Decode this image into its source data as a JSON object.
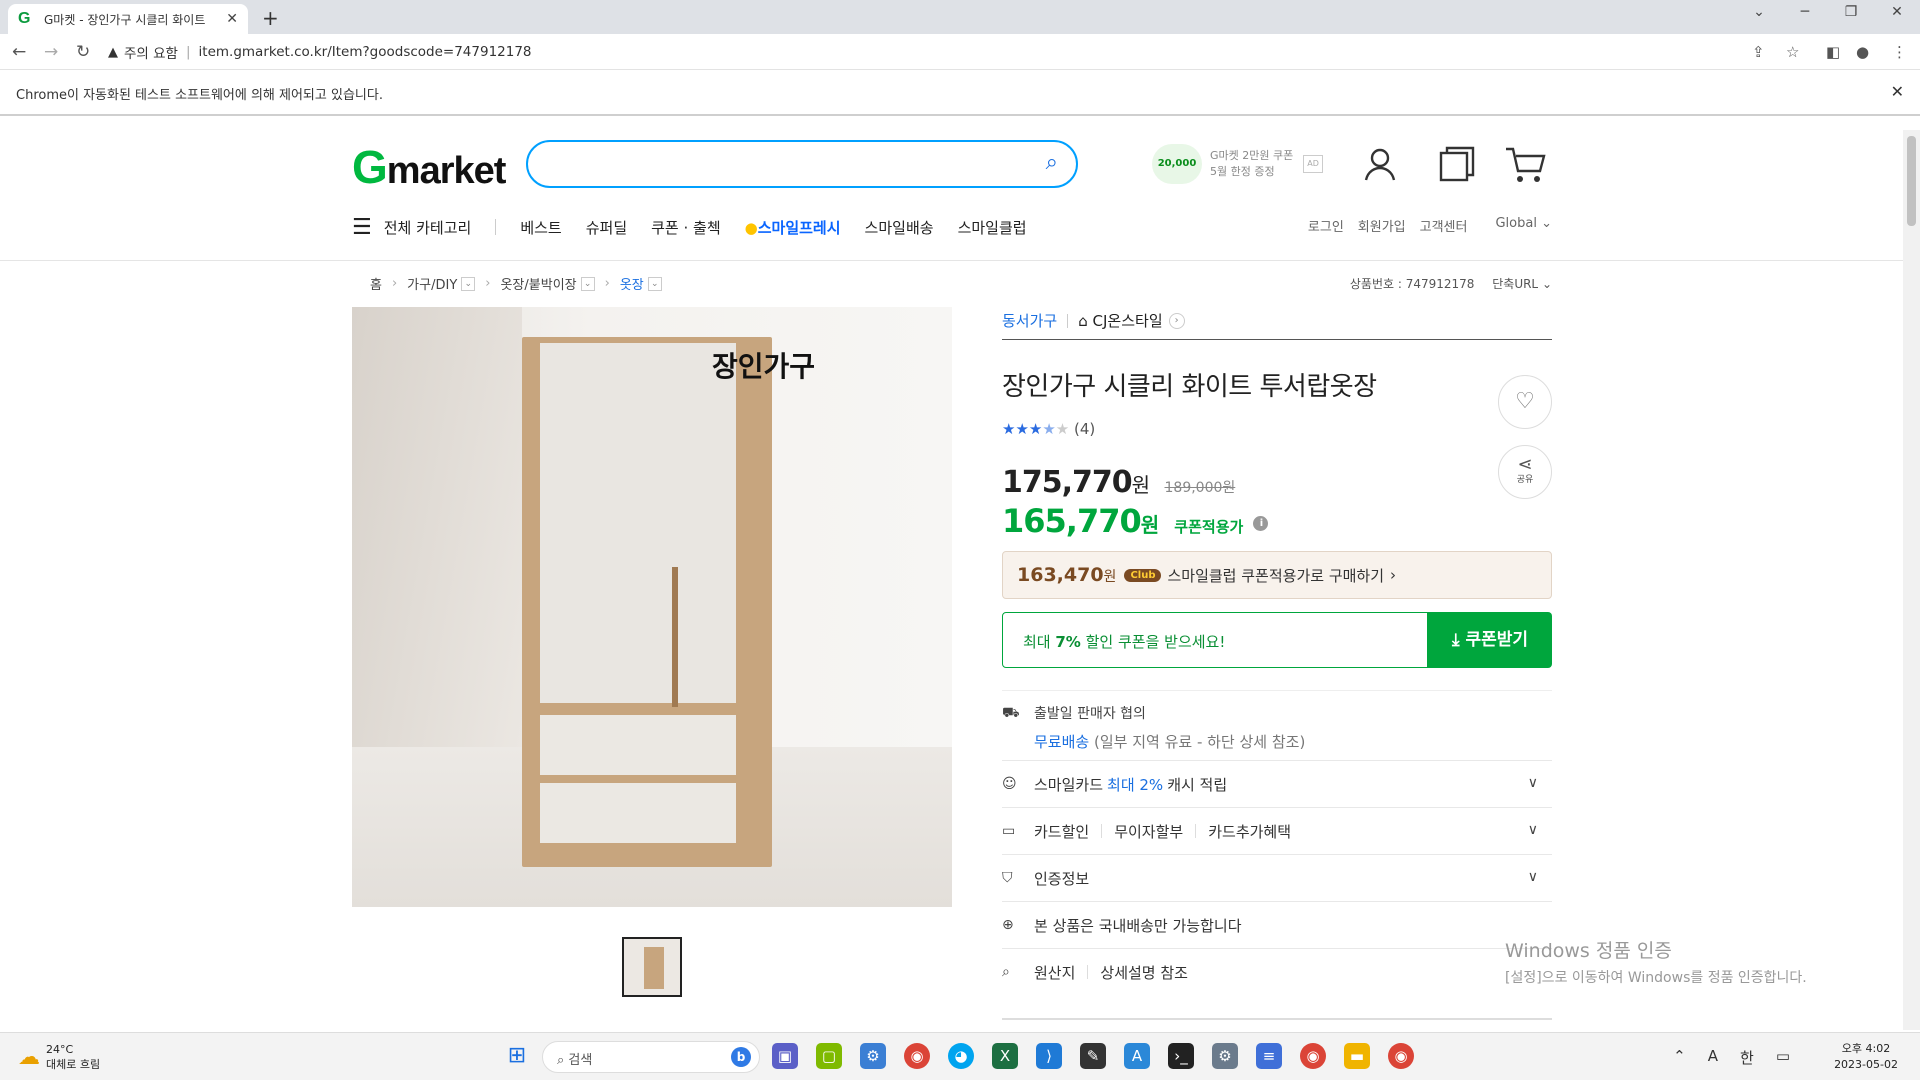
{
  "browser": {
    "tab_title": "G마켓 - 장인가구 시클리 화이트",
    "favicon": "G",
    "security": "주의 요함",
    "url": "item.gmarket.co.kr/Item?goodscode=747912178",
    "automation_notice": "Chrome이 자동화된 테스트 소프트웨어에 의해 제어되고 있습니다."
  },
  "header": {
    "logo_g": "G",
    "logo_rest": "market",
    "coupon_amount": "20,000",
    "coupon_line1": "G마켓 2만원 쿠폰",
    "coupon_line2": "5월 한정 증정",
    "ad_label": "AD",
    "nav": {
      "all_category": "전체 카테고리",
      "best": "베스트",
      "super_deal": "슈퍼딜",
      "coupon": "쿠폰 · 출첵",
      "smile_fresh": "스마일프레시",
      "smile_delivery": "스마일배송",
      "smile_club": "스마일클럽"
    },
    "util": {
      "login": "로그인",
      "signup": "회원가입",
      "support": "고객센터",
      "global": "Global"
    }
  },
  "breadcrumb": {
    "home": "홈",
    "cat1": "가구/DIY",
    "cat2": "옷장/붙박이장",
    "cat3": "옷장"
  },
  "goods_info": {
    "goods_no": "상품번호 : 747912178",
    "short_url": "단축URL"
  },
  "image": {
    "watermark": "장인가구"
  },
  "product": {
    "brand": "동서가구",
    "store": "CJ온스타일",
    "title": "장인가구 시클리 화이트 투서랍옷장",
    "rating": 3.5,
    "review_count": "(4)",
    "share_label": "공유",
    "price": "175,770",
    "price_unit": "원",
    "original_price": "189,000원",
    "coupon_price": "165,770",
    "coupon_label": "쿠폰적용가",
    "club_price": "163,470",
    "club_badge": "Club",
    "club_text": "스마일클럽 쿠폰적용가로 구매하기",
    "coupon_box_prefix": "최대 ",
    "coupon_box_bold": "7%",
    "coupon_box_suffix": " 할인 쿠폰을 받으세요!",
    "coupon_button": "쿠폰받기"
  },
  "shipping": {
    "line1": "출발일 판매자 협의",
    "free": "무료배송",
    "note": "(일부 지역 유료 - 하단 상세 참조)"
  },
  "rows": {
    "smilecard_pre": "스마일카드",
    "smilecard_blue": "최대 2%",
    "smilecard_post": "캐시 적립",
    "card_discount": "카드할인",
    "no_interest": "무이자할부",
    "card_extra": "카드추가혜택",
    "certification": "인증정보",
    "domestic": "본 상품은 국내배송만 가능합니다",
    "origin": "원산지",
    "origin_value": "상세설명 참조"
  },
  "watermark": {
    "line1": "Windows 정품 인증",
    "line2": "[설정]으로 이동하여 Windows를 정품 인증합니다."
  },
  "taskbar": {
    "temp": "24°C",
    "weather": "대체로 흐림",
    "search": "검색",
    "time": "오후 4:02",
    "date": "2023-05-02",
    "ime": "한",
    "font_a": "A"
  }
}
